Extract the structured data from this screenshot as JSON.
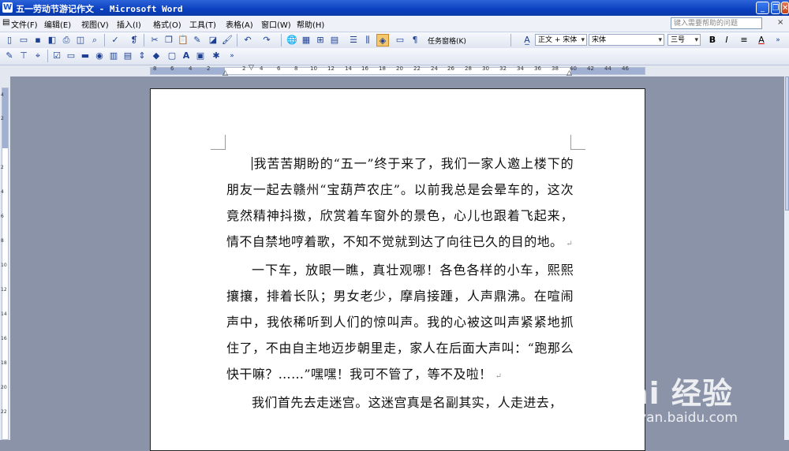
{
  "window": {
    "title": "五一劳动节游记作文 - Microsoft Word",
    "controls": [
      "minimize",
      "maximize",
      "close"
    ]
  },
  "menubar": {
    "items": [
      "文件(F)",
      "编辑(E)",
      "视图(V)",
      "插入(I)",
      "格式(O)",
      "工具(T)",
      "表格(A)",
      "窗口(W)",
      "帮助(H)"
    ],
    "help_placeholder": "键入需要帮助的问题"
  },
  "toolbar_standard": {
    "task_pane_label": "任务窗格(K)",
    "style_value": "正文 + 宋体",
    "font_value": "宋体",
    "size_value": "三号",
    "bold_label": "B",
    "italic_label": "I",
    "font_color_label": "A"
  },
  "ruler": {
    "horizontal_ticks": [
      "8",
      "6",
      "4",
      "2",
      "2",
      "4",
      "6",
      "8",
      "10",
      "12",
      "14",
      "16",
      "18",
      "20",
      "22",
      "24",
      "26",
      "28",
      "30",
      "32",
      "34",
      "36",
      "38",
      "40",
      "42",
      "44",
      "46",
      "48"
    ],
    "vertical_ticks": [
      "4",
      "2",
      "2",
      "4",
      "6",
      "8",
      "10",
      "12",
      "14",
      "16",
      "18",
      "20",
      "22"
    ]
  },
  "document": {
    "paragraphs": [
      "我苦苦期盼的“五一”终于来了，我们一家人邀上楼下的朋友一起去赣州“宝葫芦农庄”。以前我总是会晕车的，这次竟然精神抖擞，欣赏着车窗外的景色，心儿也跟着飞起来，情不自禁地哼着歌，不知不觉就到达了向往已久的目的地。",
      "一下车，放眼一瞧，真壮观哪！各色各样的小车，熙熙攘攘，排着长队；男女老少，摩肩接踵，人声鼎沸。在喧闹声中，我依稀听到人们的惊叫声。我的心被这叫声紧紧地抓住了，不由自主地迈步朝里走，家人在后面大声叫：“跑那么快干嘛？……”嘿嘿！我可不管了，等不及啦！",
      "我们首先去走迷宫。这迷宫真是名副其实，人走进去，"
    ],
    "paragraph_mark": "↵"
  },
  "watermark": {
    "brand": "Bai 经验",
    "url": "jingyan.baidu.com"
  },
  "colors": {
    "titlebar": "#0a3fbe",
    "workspace": "#8a93a8",
    "page": "#ffffff"
  }
}
